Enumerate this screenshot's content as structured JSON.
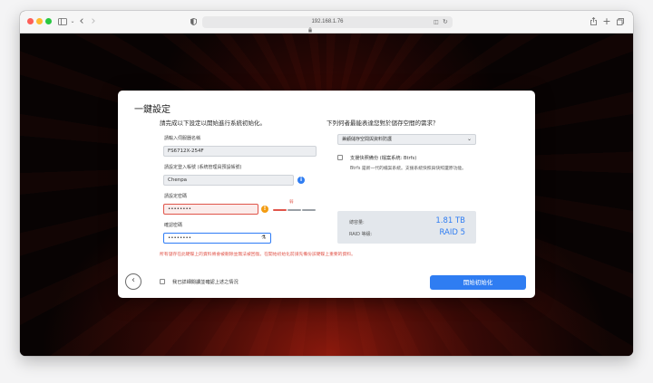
{
  "browser": {
    "url": "192.168.1.76"
  },
  "wizard": {
    "title": "一鍵設定",
    "left_heading": "請完成以下設定以開始進行系統初始化。",
    "right_heading": "下列何者最能表達您對於儲存空間的需求？",
    "server_name": {
      "label": "請輸入伺服器名稱",
      "value": "FS6712X-254F"
    },
    "username": {
      "label": "請設定登入帳號 (系統管理員預設帳號)",
      "value": "Chenpa"
    },
    "password": {
      "label": "請設定密碼",
      "value": "••••••••",
      "strength_label": "弱"
    },
    "confirm_password": {
      "label": "確認密碼",
      "value": "••••••••"
    },
    "warning": "所有儲存在此硬碟上的資料將會被刪除並無法被回復。在開始初始化前請先備份該硬碟上重要的資料。",
    "storage_select": {
      "value": "兼顧儲存空間與資料防護"
    },
    "snapshot_option": {
      "label": "支援快照備份 (檔案系統: Btrfs)",
      "description": "Btrfs 是新一代的檔案系統。支援系統快照與快照還原功能。",
      "checked": false
    },
    "summary": {
      "capacity_label": "總容量:",
      "capacity_value": "1.81 TB",
      "raid_label": "RAID 等級:",
      "raid_value": "RAID 5"
    },
    "confirm_checkbox_label": "我已詳細閱讀並確認上述之情況",
    "start_button": "開始初始化"
  },
  "colors": {
    "accent": "#2f7df2",
    "error": "#e0554a",
    "warning_icon": "#f39c12"
  }
}
